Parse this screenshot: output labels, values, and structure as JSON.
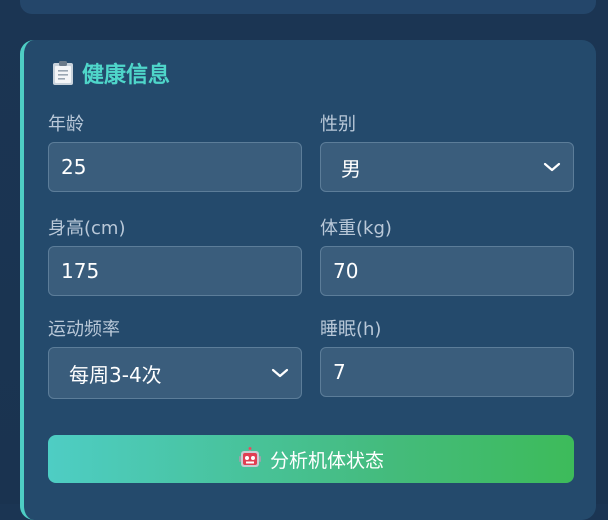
{
  "card": {
    "title": "健康信息",
    "title_icon": "clipboard-icon",
    "accent_color": "#4ecdc4"
  },
  "fields": {
    "age": {
      "label": "年龄",
      "value": "25"
    },
    "gender": {
      "label": "性别",
      "value": "男"
    },
    "height": {
      "label": "身高(cm)",
      "value": "175"
    },
    "weight": {
      "label": "体重(kg)",
      "value": "70"
    },
    "exercise": {
      "label": "运动频率",
      "value": "每周3-4次"
    },
    "sleep": {
      "label": "睡眠(h)",
      "value": "7"
    }
  },
  "button": {
    "label": "分析机体状态",
    "icon": "robot-icon",
    "gradient": [
      "#4ecdc4",
      "#3dbb5a"
    ]
  }
}
